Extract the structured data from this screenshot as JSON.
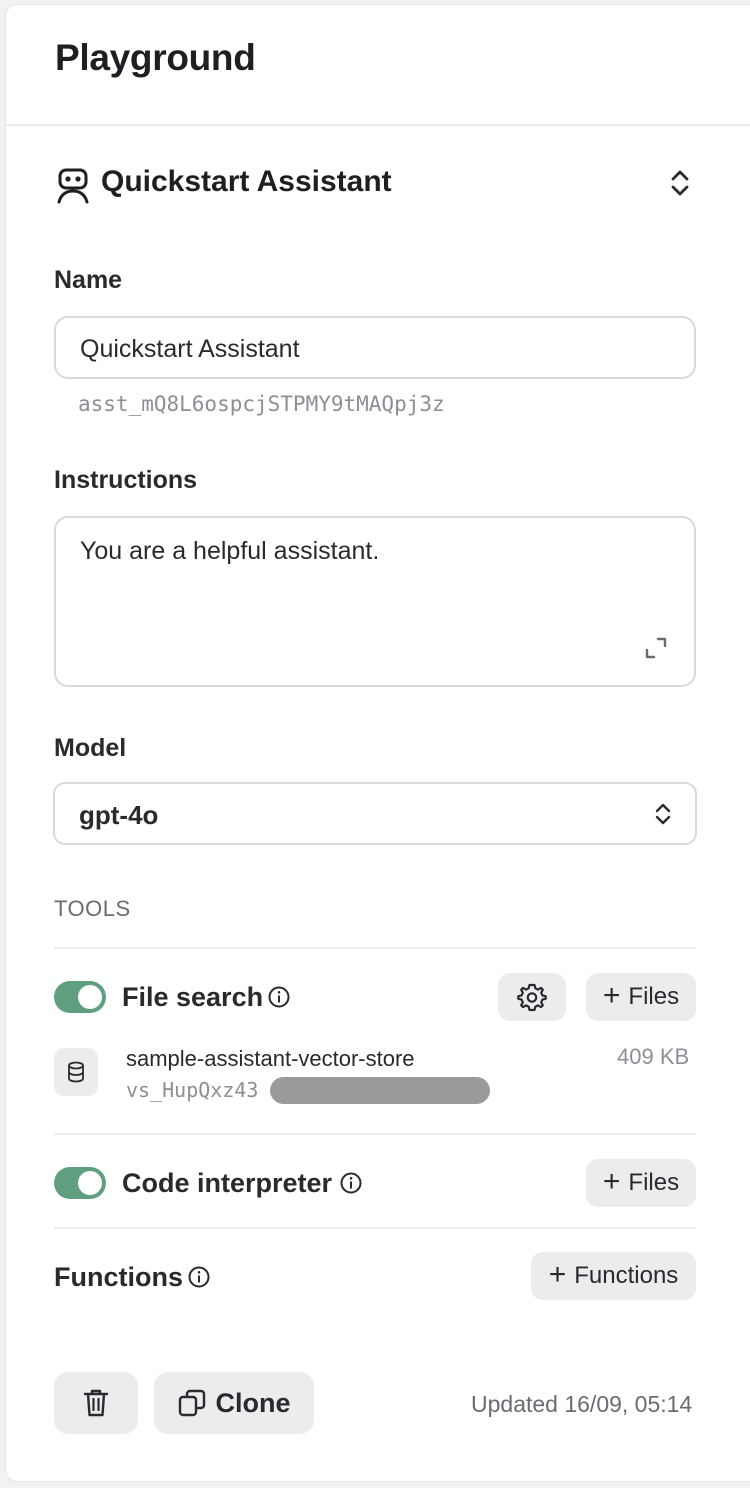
{
  "header": {
    "title": "Playground"
  },
  "assistant": {
    "title": "Quickstart Assistant"
  },
  "name_field": {
    "label": "Name",
    "value": "Quickstart Assistant",
    "assistant_id": "asst_mQ8L6ospcjSTPMY9tMAQpj3z"
  },
  "instructions_field": {
    "label": "Instructions",
    "value": "You are a helpful assistant."
  },
  "model_field": {
    "label": "Model",
    "value": "gpt-4o"
  },
  "tools": {
    "heading": "TOOLS",
    "file_search": {
      "label": "File search",
      "enabled": true,
      "files_button": "Files",
      "vector_store": {
        "name": "sample-assistant-vector-store",
        "id": "vs_HupQxz43",
        "size": "409 KB"
      }
    },
    "code_interpreter": {
      "label": "Code interpreter",
      "enabled": true,
      "files_button": "Files"
    },
    "functions": {
      "label": "Functions",
      "button": "Functions"
    }
  },
  "footer": {
    "clone_label": "Clone",
    "updated": "Updated 16/09, 05:14"
  },
  "colors": {
    "toggle_on": "#5f9e7f",
    "button_bg": "#ececef",
    "muted_text": "#8e8e96"
  }
}
